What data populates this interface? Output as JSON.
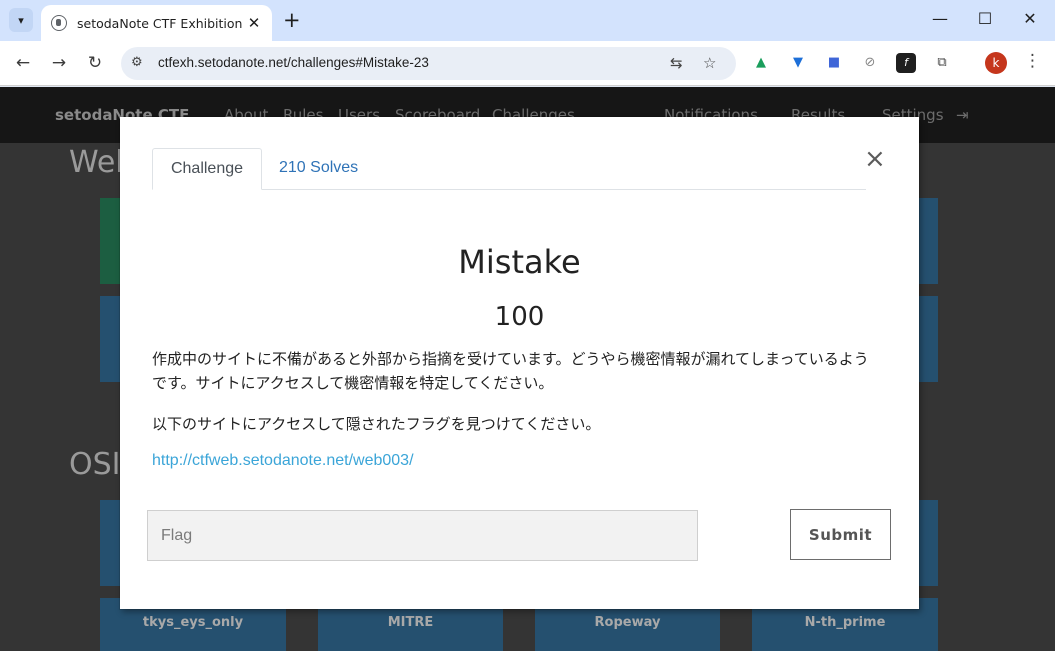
{
  "browser": {
    "tab_title": "setodaNote CTF Exhibition",
    "url": "ctfexh.setodanote.net/challenges#Mistake-23",
    "profile_initial": "k"
  },
  "site": {
    "brand": "setodaNote CTF",
    "nav_left": [
      "About",
      "Rules",
      "Users",
      "Scoreboard",
      "Challenges"
    ],
    "nav_right": [
      "Notifications",
      "Results",
      "Settings"
    ],
    "sections": [
      "Web",
      "OSINT"
    ],
    "bottom_cards": [
      "tkys_eys_only",
      "MITRE",
      "Ropeway",
      "N-th_prime"
    ]
  },
  "modal": {
    "tabs": [
      "Challenge",
      "210 Solves"
    ],
    "close": "×",
    "challenge_name": "Mistake",
    "value": "100",
    "description": [
      "作成中のサイトに不備があると外部から指摘を受けています。どうやら機密情報が漏れてしまっているようです。サイトにアクセスして機密情報を特定してください。",
      "以下のサイトにアクセスして隠されたフラグを見つけてください。"
    ],
    "link": "http://ctfweb.setodanote.net/web003/",
    "flag_placeholder": "Flag",
    "submit_label": "Submit"
  },
  "colors": {
    "tabstrip": "#d3e3fd",
    "page_bg": "#343434",
    "card_blue": "#25506f",
    "card_green": "#1c5e41",
    "link": "#3ba5d8",
    "tab_link": "#2f73b7"
  }
}
